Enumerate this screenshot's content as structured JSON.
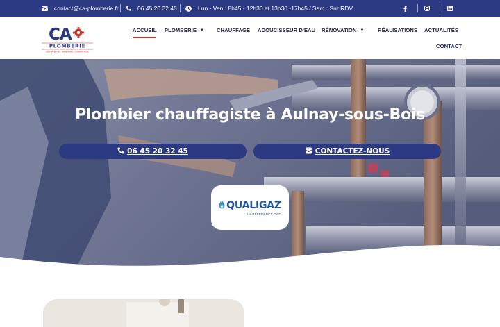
{
  "topbar": {
    "email": "contact@ca-plomberie.fr",
    "phone": "06 45 20 32 45",
    "hours": "Lun - Ven : 8h45 - 12h30 et 13h30 -17h45 / Sam : Sur RDV",
    "socials": [
      "facebook-icon",
      "instagram-icon",
      "linkedin-icon"
    ]
  },
  "logo": {
    "mark": "CA",
    "name": "PLOMBERIE",
    "tagline": "DÉPANNAGE · SANITAIRE · CHAUFFAGE"
  },
  "nav": {
    "items": [
      {
        "label": "ACCUEIL",
        "active": true
      },
      {
        "label": "PLOMBERIE",
        "dropdown": true
      },
      {
        "label": "CHAUFFAGE"
      },
      {
        "label": "ADOUCISSEUR D'EAU"
      },
      {
        "label": "RÉNOVATION",
        "dropdown": true
      },
      {
        "label": "RÉALISATIONS"
      },
      {
        "label": "ACTUALITÉS"
      },
      {
        "label": "CONTACT"
      }
    ]
  },
  "hero": {
    "title": "Plombier chauffagiste à Aulnay-sous-Bois",
    "phone_button": "06 45 20 32 45",
    "contact_button": "CONTACTEZ-NOUS",
    "badge": {
      "title": "QUALIGAZ",
      "subtitle": "LA RÉFÉRENCE GAZ"
    }
  },
  "colors": {
    "primary": "#2b3a82",
    "accent": "#c0392b",
    "nav_text": "#1b2453",
    "qualigaz": "#1e56a0"
  }
}
